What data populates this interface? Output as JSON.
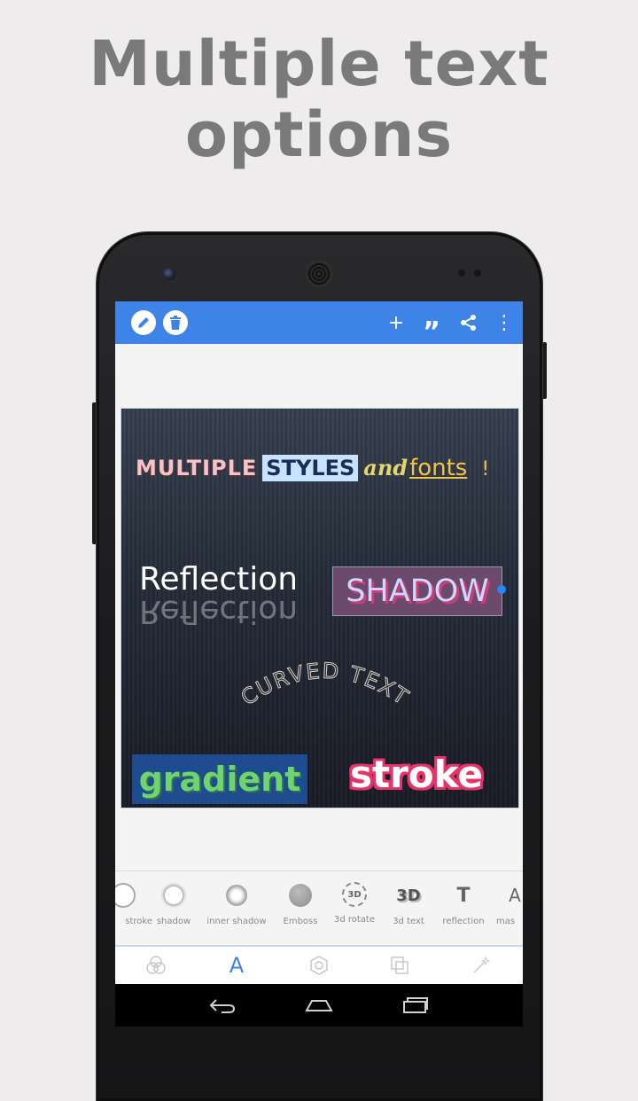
{
  "headline": {
    "line1": "Multiple text",
    "line2": "options"
  },
  "appbar": {
    "edit_icon": "pencil-icon",
    "delete_icon": "trash-icon",
    "actions": [
      {
        "icon": "plus-icon",
        "glyph": "+"
      },
      {
        "icon": "quote-icon",
        "glyph": "”"
      },
      {
        "icon": "share-icon",
        "glyph": ""
      },
      {
        "icon": "more-vertical-icon",
        "glyph": "⋮"
      }
    ]
  },
  "canvas": {
    "line1": {
      "multiple": "MULTIPLE",
      "styles": "STYLES",
      "and": "and",
      "fonts": "fonts",
      "excl": "!"
    },
    "reflection": "Reflection",
    "shadow": "SHADOW",
    "curved": "CURVED TEXT",
    "gradient": "gradient",
    "stroke": "stroke"
  },
  "tools": [
    {
      "label": "stroke",
      "icon": "stroke-circle-icon"
    },
    {
      "label": "shadow",
      "icon": "shadow-circle-icon"
    },
    {
      "label": "inner shadow",
      "icon": "inner-shadow-circle-icon"
    },
    {
      "label": "Emboss",
      "icon": "emboss-circle-icon"
    },
    {
      "label": "3d rotate",
      "icon": "3d-rotate-icon"
    },
    {
      "label": "3d text",
      "icon": "3d-text-icon"
    },
    {
      "label": "reflection",
      "icon": "reflection-icon"
    },
    {
      "label": "mas",
      "icon": "mask-icon"
    }
  ],
  "tool_glyphs": {
    "rotate": "3D",
    "text3d": "3D",
    "reflection": "T",
    "mask": "A"
  },
  "tabs": [
    "filters-tab-icon",
    "text-tab-icon",
    "shape-tab-icon",
    "layers-tab-icon",
    "magic-wand-tab-icon"
  ],
  "tab_text_glyph": "A",
  "colors": {
    "accent": "#3d83e8",
    "headline": "#7a7a7a",
    "background": "#eeeced"
  }
}
